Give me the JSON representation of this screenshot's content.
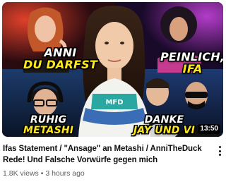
{
  "video": {
    "title": "Ifas Statement / \"Ansage\" an Metashi / AnniTheDuck Rede! Und Falsche Vorwürfe gegen mich",
    "views": "1.8K views",
    "separator": "•",
    "age": "3 hours ago",
    "duration": "13:50"
  },
  "thumbnail": {
    "overlays": [
      {
        "line1": "ANNI",
        "line2": "DU DARFST",
        "color1": "#ffffff",
        "color2": "#ffe81a"
      },
      {
        "line1": "PEINLICH,",
        "line2": "IFA",
        "color1": "#ffffff",
        "color2": "#ffe81a"
      },
      {
        "line1": "RUHIG",
        "line2": "METASHI",
        "color1": "#ffffff",
        "color2": "#ffe81a"
      },
      {
        "line1": "DANKE",
        "line2": "JAY UND VI",
        "color1": "#ffffff",
        "color2": "#ffe81a"
      }
    ],
    "shirt_text": "MFD"
  },
  "icons": {
    "menu": "more-vertical-icon"
  }
}
